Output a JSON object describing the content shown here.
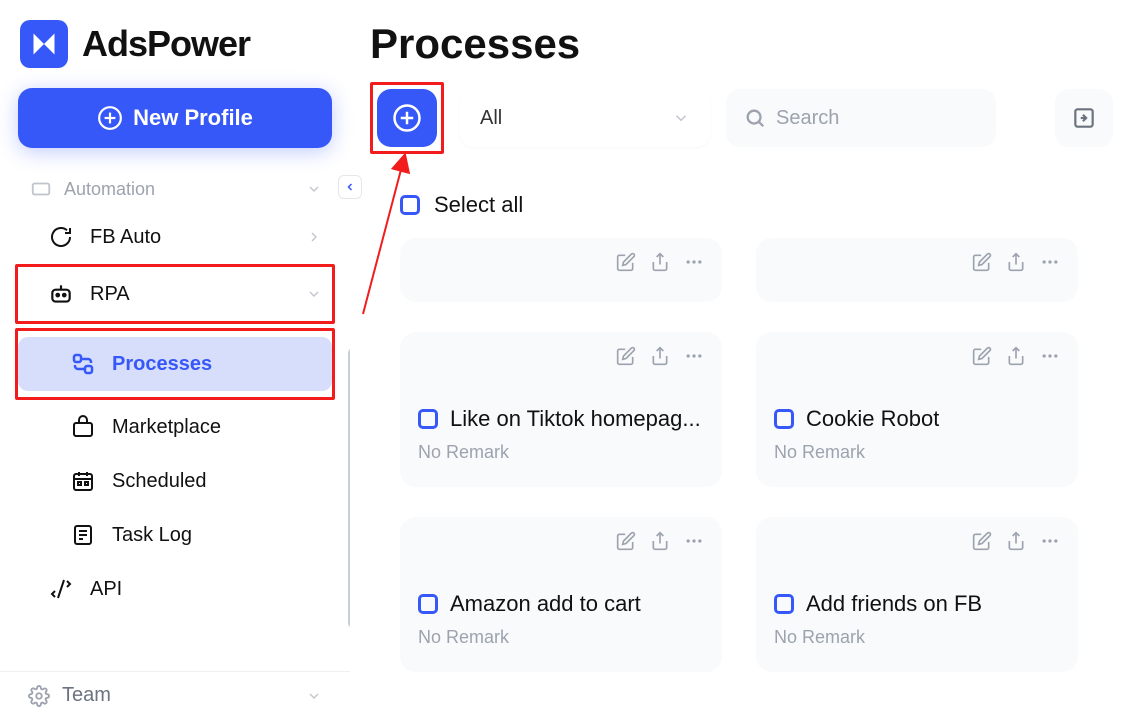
{
  "brand": "AdsPower",
  "sidebar": {
    "new_profile": "New Profile",
    "automation": "Automation",
    "items": {
      "fbauto": "FB Auto",
      "rpa": "RPA",
      "processes": "Processes",
      "marketplace": "Marketplace",
      "scheduled": "Scheduled",
      "tasklog": "Task Log",
      "api": "API"
    },
    "footer": {
      "team": "Team"
    }
  },
  "page": {
    "title": "Processes",
    "filter": {
      "value": "All"
    },
    "search": {
      "placeholder": "Search"
    },
    "select_all": "Select all"
  },
  "cards": [
    {
      "title": "Like on Tiktok homepag...",
      "remark": "No Remark"
    },
    {
      "title": "Cookie Robot",
      "remark": "No Remark"
    },
    {
      "title": "Amazon add to cart",
      "remark": "No Remark"
    },
    {
      "title": "Add friends on FB",
      "remark": "No Remark"
    }
  ]
}
